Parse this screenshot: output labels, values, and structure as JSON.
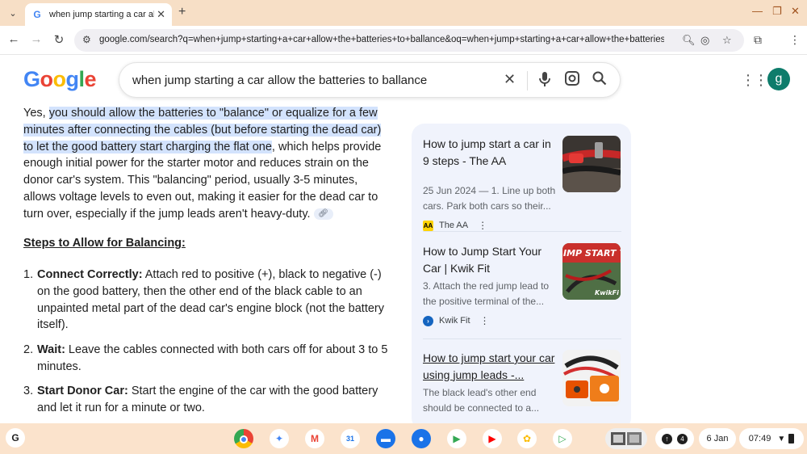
{
  "browser": {
    "tab_title": "when jump starting a car allow",
    "tab_favicon": "G",
    "url": "google.com/search?q=when+jump+starting+a+car+allow+the+batteries+to+ballance&oq=when+jump+starting+a+car+allow+the+batteries+to+b..."
  },
  "search": {
    "logo": "Google",
    "query": "when jump starting a car allow the batteries to ballance",
    "avatar": "g"
  },
  "answer": {
    "lead": "Yes, ",
    "highlight": "you should allow the batteries to \"balance\" or equalize for a few minutes after connecting the cables (but before starting the dead car) to let the good battery start charging the flat one",
    "rest": ", which helps provide enough initial power for the starter motor and reduces strain on the donor car's system. This \"balancing\" period, usually 3-5 minutes, allows voltage levels to even out, making it easier for the dead car to turn over, especially if the jump leads aren't heavy-duty.",
    "steps_heading": "Steps to Allow for Balancing:",
    "steps": [
      {
        "num": "1.",
        "title": "Connect Correctly:",
        "text": " Attach red to positive (+), black to negative (-) on the good battery, then the other end of the black cable to an unpainted metal part of the dead car's engine block (not the battery itself)."
      },
      {
        "num": "2.",
        "title": "Wait:",
        "text": " Leave the cables connected with both cars off for about 3 to 5 minutes."
      },
      {
        "num": "3.",
        "title": "Start Donor Car:",
        "text": " Start the engine of the car with the good battery and let it run for a minute or two."
      }
    ]
  },
  "sources": [
    {
      "title": "How to jump start a car in 9 steps - The AA",
      "snippet": "25 Jun 2024 — 1. Line up both cars. Park both cars so their...",
      "site": "The AA",
      "site_logo": "AA"
    },
    {
      "title": "How to Jump Start Your Car | Kwik Fit",
      "snippet": "3. Attach the red jump lead to the positive terminal of the...",
      "site": "Kwik Fit",
      "thumb_text": "IMP START YO",
      "thumb_text2": "KwikFi"
    },
    {
      "title": "How to jump start your car using jump leads -...",
      "snippet": "The black lead's other end should be connected to a..."
    }
  ],
  "shelf": {
    "launcher": "G",
    "notification_count": "4",
    "date": "6 Jan",
    "time": "07:49"
  }
}
